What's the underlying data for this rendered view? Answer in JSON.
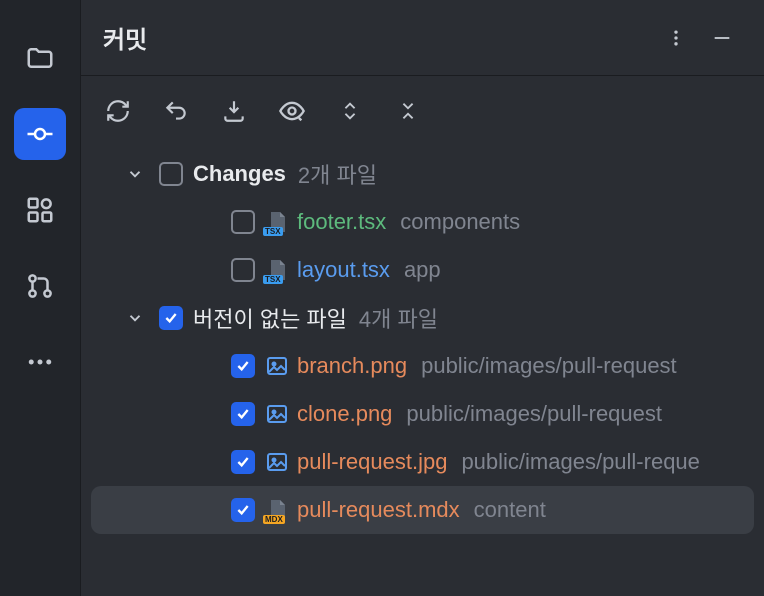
{
  "panel": {
    "title": "커밋"
  },
  "groups": [
    {
      "label": "Changes",
      "count": "2개 파일",
      "checked": false
    },
    {
      "label": "버전이 없는 파일",
      "count": "4개 파일",
      "checked": true
    }
  ],
  "files": {
    "changes": [
      {
        "name": "footer.tsx",
        "path": "components",
        "icon": "tsx",
        "color": "green",
        "checked": false
      },
      {
        "name": "layout.tsx",
        "path": "app",
        "icon": "tsx",
        "color": "blue",
        "checked": false
      }
    ],
    "unversioned": [
      {
        "name": "branch.png",
        "path": "public/images/pull-request",
        "icon": "image",
        "color": "orange",
        "checked": true
      },
      {
        "name": "clone.png",
        "path": "public/images/pull-request",
        "icon": "image",
        "color": "orange",
        "checked": true
      },
      {
        "name": "pull-request.jpg",
        "path": "public/images/pull-reque",
        "icon": "image",
        "color": "orange",
        "checked": true
      },
      {
        "name": "pull-request.mdx",
        "path": "content",
        "icon": "mdx",
        "color": "orange",
        "checked": true,
        "selected": true
      }
    ]
  }
}
